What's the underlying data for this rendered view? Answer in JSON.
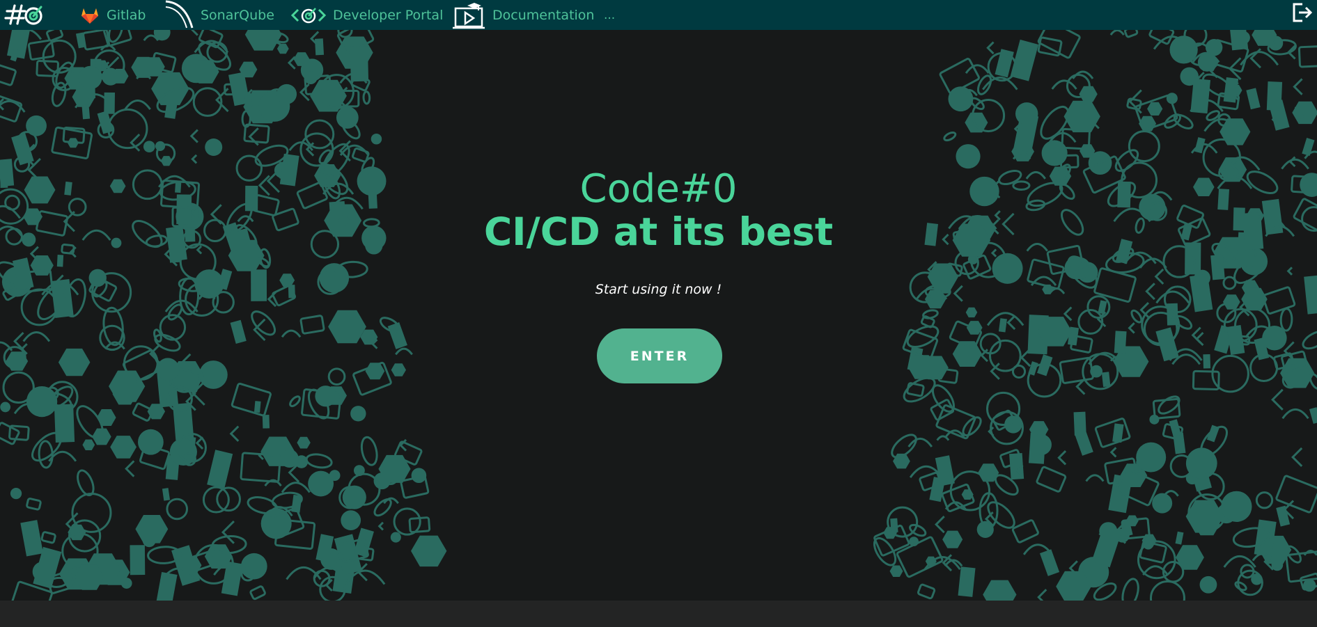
{
  "nav": {
    "brand_text": "#©",
    "items": [
      {
        "label": "Gitlab",
        "icon": "gitlab-icon"
      },
      {
        "label": "SonarQube",
        "icon": "sonarqube-icon"
      },
      {
        "label": "Developer Portal",
        "icon": "developer-portal-icon"
      },
      {
        "label": "Documentation",
        "icon": "documentation-icon"
      }
    ],
    "more_label": "...",
    "logout_icon": "logout-icon"
  },
  "hero": {
    "title": "Code#0",
    "tagline": "CI/CD at its best",
    "subtitle": "Start using it now !",
    "enter_label": "ENTER"
  },
  "colors": {
    "topbar": "#003a40",
    "accent": "#4ad59a",
    "button": "#52b28f",
    "background": "#171919",
    "pattern": "#2a6b60"
  }
}
